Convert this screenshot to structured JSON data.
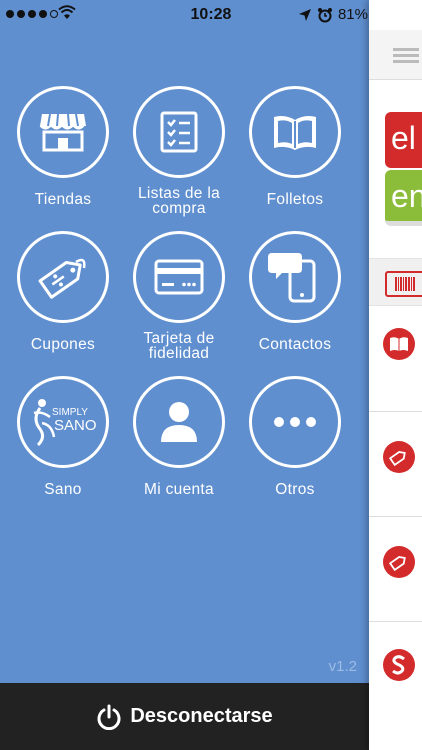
{
  "status_bar": {
    "time": "10:28",
    "battery": "81%",
    "battery_level": 0.81
  },
  "menu": {
    "items": [
      {
        "label": "Tiendas",
        "icon": "store-icon"
      },
      {
        "label": "Listas de la compra",
        "icon": "checklist-icon"
      },
      {
        "label": "Folletos",
        "icon": "book-icon"
      },
      {
        "label": "Cupones",
        "icon": "coupon-tag-icon"
      },
      {
        "label": "Tarjeta de fidelidad",
        "icon": "credit-card-icon"
      },
      {
        "label": "Contactos",
        "icon": "phone-chat-icon"
      },
      {
        "label": "Sano",
        "icon": "simply-sano-logo"
      },
      {
        "label": "Mi cuenta",
        "icon": "user-icon"
      },
      {
        "label": "Otros",
        "icon": "more-dots-icon"
      }
    ],
    "version": "v1.2",
    "logout_label": "Desconectarse"
  },
  "side_panel": {
    "logo_top": "el",
    "logo_bottom": "en",
    "colors": {
      "red": "#d32b2b",
      "green": "#8cbd3a"
    }
  },
  "simply_sano_logo": {
    "line1": "SIMPLY",
    "line2": "SANO"
  }
}
